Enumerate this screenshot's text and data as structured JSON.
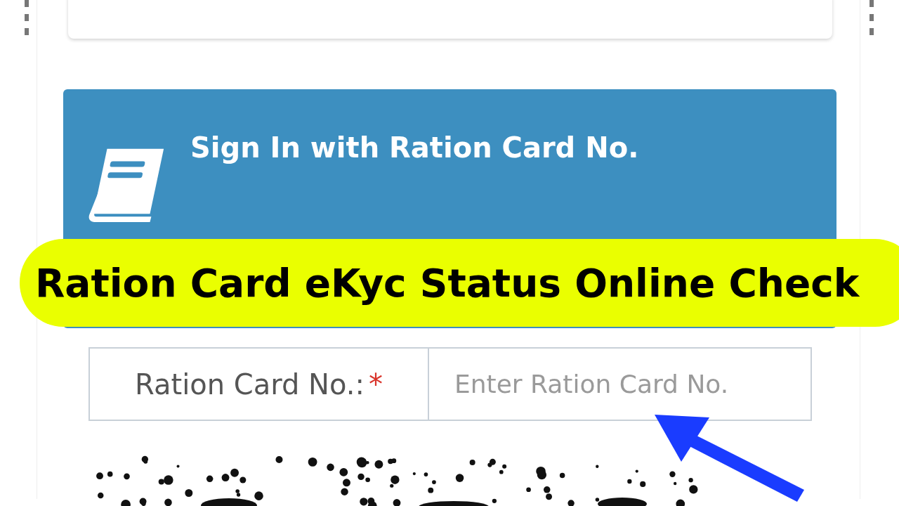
{
  "header": {
    "title": "Sign In with Ration Card No."
  },
  "banner": {
    "text": "Ration Card eKyc Status Online Check"
  },
  "form": {
    "fields": [
      {
        "label": "Ration Card No.:",
        "required_mark": "*",
        "placeholder": "Enter Ration Card No."
      }
    ]
  }
}
